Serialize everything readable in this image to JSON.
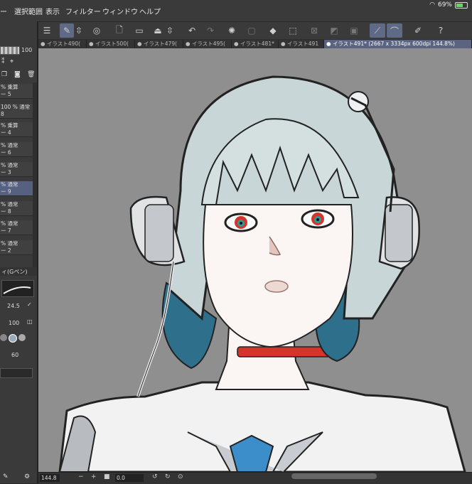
{
  "menubar": {
    "items": [
      "ー",
      "選択範囲",
      "表示",
      "フィルター",
      "ウィンドウ",
      "ヘルプ"
    ],
    "battery_percent": "69%"
  },
  "tabs": [
    "イラスト490(",
    "イラスト500(",
    "イラスト479(",
    "イラスト495(",
    "イラスト481*",
    "イラスト491",
    "イラスト491* (2667 x 3334px 600dpi 144.8%)"
  ],
  "left_panel": {
    "brush_size_top": "100",
    "layers": [
      {
        "blend": "乗算",
        "name": "ー 5"
      },
      {
        "blend": "100 % 通常",
        "name": ""
      },
      {
        "blend": "乗算",
        "name": "ー 4"
      },
      {
        "blend": "通常",
        "name": "ー 6"
      },
      {
        "blend": "通常",
        "name": "ー 3"
      },
      {
        "blend": "通常",
        "name": "ー 9"
      },
      {
        "blend": "通常",
        "name": "ー 8"
      },
      {
        "blend": "通常",
        "name": "ー 7"
      },
      {
        "blend": "通常",
        "name": "ー 2"
      }
    ],
    "tool_name": "ィ(Gペン)",
    "brush_size": "24.5",
    "opacity": "100",
    "aa_value": "60"
  },
  "bottom": {
    "zoom": "144.8",
    "rotation": "0.0"
  },
  "colors": {
    "accent": "#5a6480",
    "canvas_bg": "#8f8f8f",
    "choker": "#d8332a"
  }
}
